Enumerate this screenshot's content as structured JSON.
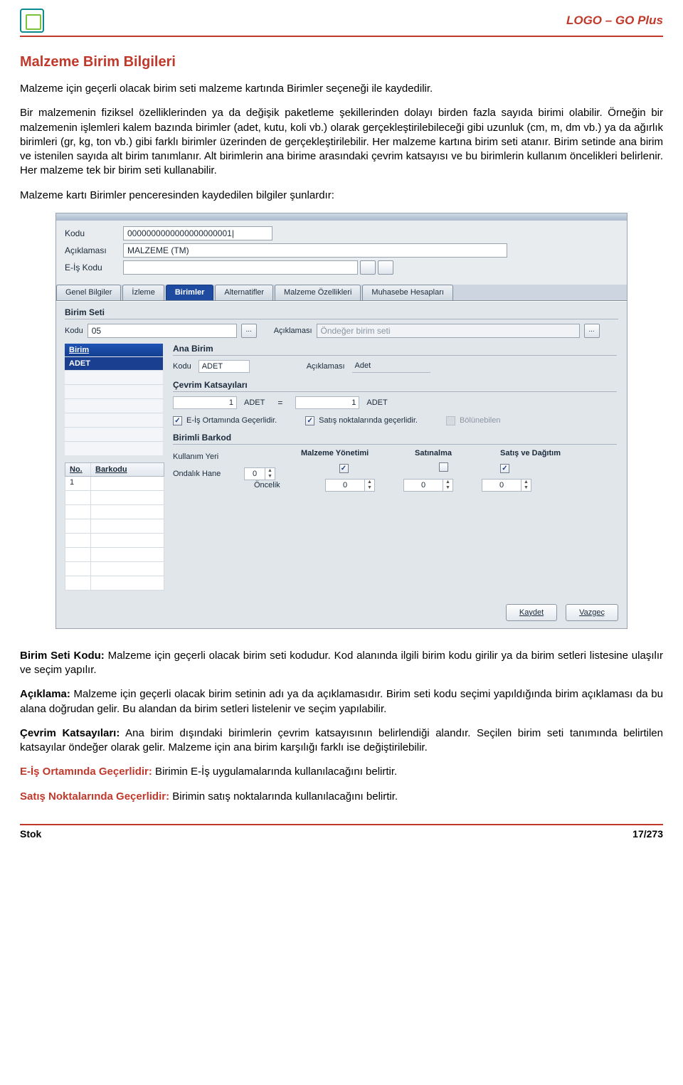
{
  "header": {
    "brand": "LOGO – GO Plus"
  },
  "doc": {
    "title": "Malzeme Birim Bilgileri",
    "p1": "Malzeme için geçerli olacak birim seti malzeme kartında Birimler seçeneği ile kaydedilir.",
    "p2": "Bir malzemenin fiziksel özelliklerinden ya da değişik paketleme şekillerinden dolayı birden fazla sayıda birimi olabilir. Örneğin bir malzemenin işlemleri kalem bazında birimler (adet, kutu, koli vb.) olarak gerçekleştirilebileceği gibi uzunluk (cm, m, dm vb.) ya da ağırlık birimleri (gr, kg, ton vb.) gibi farklı birimler üzerinden de gerçekleştirilebilir. Her malzeme kartına birim seti atanır. Birim setinde ana birim ve istenilen sayıda alt birim tanımlanır. Alt birimlerin ana birime arasındaki çevrim katsayısı ve bu birimlerin kullanım öncelikleri belirlenir. Her malzeme tek bir birim seti kullanabilir.",
    "p3": "Malzeme kartı Birimler penceresinden kaydedilen bilgiler şunlardır:",
    "def1_t": "Birim Seti Kodu:",
    "def1": " Malzeme için geçerli olacak birim seti kodudur. Kod alanında ilgili birim kodu girilir ya da birim setleri listesine ulaşılır ve seçim yapılır.",
    "def2_t": "Açıklama:",
    "def2": " Malzeme için geçerli olacak birim setinin adı ya da açıklamasıdır. Birim seti kodu seçimi yapıldığında birim açıklaması da bu alana doğrudan gelir. Bu alandan da birim setleri listelenir ve seçim yapılabilir.",
    "def3_t": "Çevrim Katsayıları:",
    "def3": " Ana birim dışındaki birimlerin çevrim katsayısının belirlendiği alandır. Seçilen birim seti tanımında belirtilen katsayılar öndeğer olarak gelir. Malzeme için ana birim karşılığı farklı ise değiştirilebilir.",
    "def4_t": "E-İş Ortamında Geçerlidir:",
    "def4": " Birimin E-İş uygulamalarında kullanılacağını belirtir.",
    "def5_t": "Satış Noktalarında Geçerlidir:",
    "def5": " Birimin satış noktalarında kullanılacağını belirtir."
  },
  "win": {
    "lbl_kodu": "Kodu",
    "val_kodu": "0000000000000000000001|",
    "lbl_aciklama": "Açıklaması",
    "val_aciklama": "MALZEME (TM)",
    "lbl_eis": "E-İş Kodu",
    "tabs": {
      "t0": "Genel Bilgiler",
      "t1": "İzleme",
      "t2": "Birimler",
      "t3": "Alternatifler",
      "t4": "Malzeme Özellikleri",
      "t5": "Muhasebe Hesapları"
    },
    "bset": {
      "title": "Birim Seti",
      "kodu_l": "Kodu",
      "kodu_v": "05",
      "acik_l": "Açıklaması",
      "acik_v": "Öndeğer birim seti"
    },
    "leftlist": {
      "header": "Birim",
      "item": "ADET"
    },
    "barkod": {
      "no_h": "No.",
      "bk_h": "Barkodu",
      "row1": "1"
    },
    "anabirim": {
      "title": "Ana Birim",
      "kodu_l": "Kodu",
      "kodu_v": "ADET",
      "acik_l": "Açıklaması",
      "acik_v": "Adet"
    },
    "cevrim": {
      "title": "Çevrim Katsayıları",
      "left_v": "1",
      "left_u": "ADET",
      "eq": "=",
      "right_v": "1",
      "right_u": "ADET"
    },
    "opts": {
      "eis": "E-İş Ortamında Geçerlidir.",
      "satis": "Satış noktalarında geçerlidir.",
      "bol": "Bölünebilen"
    },
    "bbarkod": {
      "title": "Birimli Barkod",
      "kullanim_l": "Kullanım Yeri",
      "ondalik_l": "Ondalık Hane",
      "ondalik_v": "0",
      "oncelik_l": "Öncelik",
      "col1": "Malzeme Yönetimi",
      "col2": "Satınalma",
      "col3": "Satış ve Dağıtım",
      "v1": "0",
      "v2": "0",
      "v3": "0"
    },
    "btn_save": "Kaydet",
    "btn_cancel": "Vazgeç"
  },
  "footer": {
    "left": "Stok",
    "right": "17/273"
  }
}
